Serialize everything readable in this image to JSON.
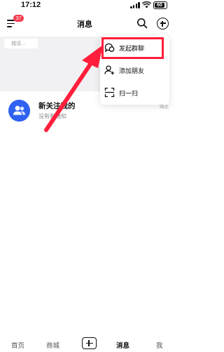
{
  "status_bar": {
    "time": "17:12",
    "battery": "60"
  },
  "header": {
    "title": "消息",
    "badge_count": "37"
  },
  "recent": {
    "chip_text": "城话..."
  },
  "list": [
    {
      "title": "新关注我的",
      "subtitle": "没有新通知",
      "time": "晦也"
    }
  ],
  "popup_menu": {
    "items": [
      {
        "label": "发起群聊",
        "icon": "group-chat-icon"
      },
      {
        "label": "添加朋友",
        "icon": "add-friend-icon"
      },
      {
        "label": "扫一扫",
        "icon": "scan-icon"
      }
    ]
  },
  "tabs": [
    {
      "label": "首页"
    },
    {
      "label": "商城"
    },
    {
      "label": "消息"
    },
    {
      "label": "我"
    }
  ],
  "colors": {
    "accent": "#ff1e3c",
    "avatar": "#2f62f0",
    "badge": "#f43a4f"
  }
}
